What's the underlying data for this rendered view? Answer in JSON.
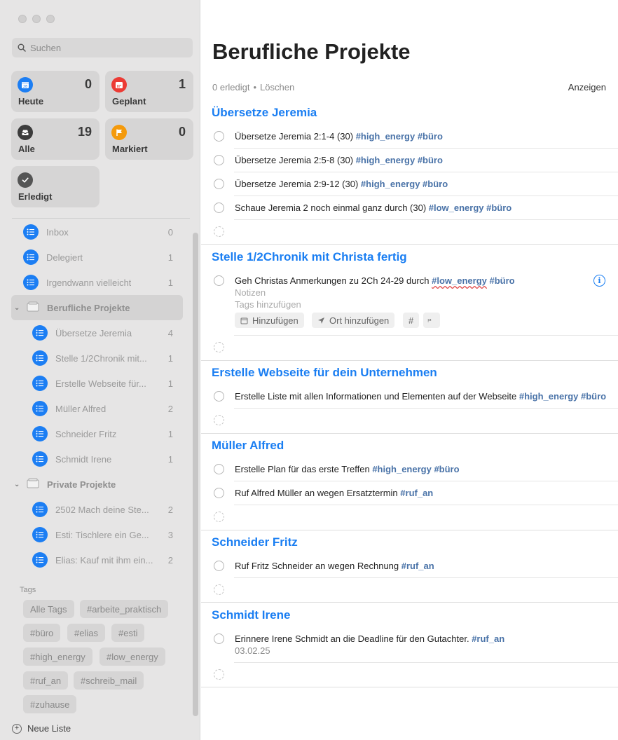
{
  "sidebar": {
    "search_placeholder": "Suchen",
    "smart_lists": [
      {
        "label": "Heute",
        "count": "0",
        "icon": "calendar-icon",
        "color": "#1c7ef3"
      },
      {
        "label": "Geplant",
        "count": "1",
        "icon": "calendar-icon",
        "color": "#ec3b35"
      },
      {
        "label": "Alle",
        "count": "19",
        "icon": "tray-icon",
        "color": "#3c3c3c"
      },
      {
        "label": "Markiert",
        "count": "0",
        "icon": "flag-icon",
        "color": "#f49a0c"
      },
      {
        "label": "Erledigt",
        "count": "",
        "icon": "checkmark-icon",
        "color": "#555555"
      }
    ],
    "lists": [
      {
        "name": "Inbox",
        "count": "0"
      },
      {
        "name": "Delegiert",
        "count": "1"
      },
      {
        "name": "Irgendwann vielleicht",
        "count": "1"
      }
    ],
    "groups": [
      {
        "name": "Berufliche Projekte",
        "items": [
          {
            "name": "Übersetze Jeremia",
            "count": "4"
          },
          {
            "name": "Stelle 1/2Chronik mit...",
            "count": "1"
          },
          {
            "name": "Erstelle Webseite für...",
            "count": "1"
          },
          {
            "name": "Müller Alfred",
            "count": "2"
          },
          {
            "name": "Schneider Fritz",
            "count": "1"
          },
          {
            "name": "Schmidt Irene",
            "count": "1"
          }
        ]
      },
      {
        "name": "Private Projekte",
        "items": [
          {
            "name": "2502 Mach deine Ste...",
            "count": "2"
          },
          {
            "name": "Esti: Tischlere ein Ge...",
            "count": "3"
          },
          {
            "name": "Elias: Kauf mit ihm ein...",
            "count": "2"
          }
        ]
      }
    ],
    "tags_title": "Tags",
    "tags": [
      "Alle Tags",
      "#arbeite_praktisch",
      "#büro",
      "#elias",
      "#esti",
      "#high_energy",
      "#low_energy",
      "#ruf_an",
      "#schreib_mail",
      "#zuhause"
    ],
    "new_list_label": "Neue Liste"
  },
  "main": {
    "title": "Berufliche Projekte",
    "done_count_text": "0 erledigt",
    "clear_label": "Löschen",
    "show_label": "Anzeigen",
    "sections": [
      {
        "title": "Übersetze Jeremia",
        "tasks": [
          {
            "text": "Übersetze Jeremia 2:1-4 (30) ",
            "tags": "#high_energy #büro"
          },
          {
            "text": "Übersetze Jeremia 2:5-8 (30) ",
            "tags": "#high_energy #büro"
          },
          {
            "text": "Übersetze Jeremia 2:9-12 (30) ",
            "tags": "#high_energy #büro"
          },
          {
            "text": "Schaue Jeremia 2 noch einmal ganz durch (30) ",
            "tags": "#low_energy #büro"
          }
        ]
      },
      {
        "title": "Stelle 1/2Chronik mit Christa fertig",
        "tasks": [
          {
            "text": "Geh Christas Anmerkungen zu 2Ch 24-29 durch ",
            "tags_a": "#low_energy",
            "tags_b": " #büro",
            "notes_placeholder": "Notizen",
            "tags_placeholder": "Tags hinzufügen",
            "add_date_label": "Hinzufügen",
            "add_location_label": "Ort hinzufügen",
            "hash_label": "#"
          }
        ]
      },
      {
        "title": "Erstelle Webseite für dein Unternehmen",
        "tasks": [
          {
            "text": "Erstelle Liste mit allen Informationen und Elementen auf der Webseite ",
            "tags": "#high_energy #büro"
          }
        ]
      },
      {
        "title": "Müller Alfred",
        "tasks": [
          {
            "text": "Erstelle Plan für das erste Treffen ",
            "tags": "#high_energy #büro"
          },
          {
            "text": "Ruf Alfred Müller an wegen Ersatztermin ",
            "tags": "#ruf_an"
          }
        ]
      },
      {
        "title": "Schneider Fritz",
        "tasks": [
          {
            "text": "Ruf Fritz Schneider an wegen Rechnung ",
            "tags": "#ruf_an"
          }
        ]
      },
      {
        "title": "Schmidt Irene",
        "tasks": [
          {
            "text": "Erinnere Irene Schmidt an die Deadline für den Gutachter. ",
            "tags": "#ruf_an",
            "date": "03.02.25"
          }
        ]
      }
    ]
  }
}
